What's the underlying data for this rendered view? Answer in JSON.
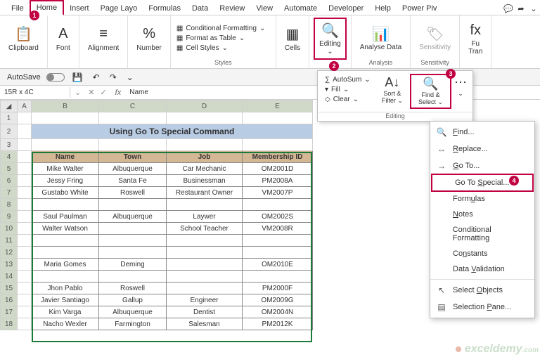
{
  "tabs": [
    "File",
    "Home",
    "Insert",
    "Page Layo",
    "Formulas",
    "Data",
    "Review",
    "View",
    "Automate",
    "Developer",
    "Help",
    "Power Piv"
  ],
  "ribbon": {
    "clipboard": "Clipboard",
    "font": "Font",
    "alignment": "Alignment",
    "number": "Number",
    "styles_label": "Styles",
    "cond_fmt": "Conditional Formatting",
    "fmt_table": "Format as Table",
    "cell_styles": "Cell Styles",
    "cells": "Cells",
    "editing": "Editing",
    "analysis_label": "Analysis",
    "analyse": "Analyse Data",
    "sensitivity_label": "Sensitivity",
    "sensitivity": "Sensitivity",
    "fu": "Fu",
    "tran": "Tran"
  },
  "autosave": "AutoSave",
  "dropdown": {
    "autosum": "AutoSum",
    "fill": "Fill",
    "clear": "Clear",
    "sort": "Sort & Filter",
    "find": "Find & Select",
    "editing": "Editing"
  },
  "menu": {
    "find": "Find...",
    "replace": "Replace...",
    "goto": "Go To...",
    "special": "Go To Special...",
    "formulas": "Formulas",
    "notes": "Notes",
    "cond": "Conditional Formatting",
    "constants": "Constants",
    "dataval": "Data Validation",
    "selobj": "Select Objects",
    "selpane": "Selection Pane..."
  },
  "namebox": "15R x 4C",
  "fx_value": "Name",
  "title": "Using Go To Special Command",
  "headers": [
    "Name",
    "Town",
    "Job",
    "Membership ID"
  ],
  "rows": [
    [
      "Mike Walter",
      "Albuquerque",
      "Car Mechanic",
      "OM2001D"
    ],
    [
      "Jessy Fring",
      "Santa Fe",
      "Businessman",
      "PM2008A"
    ],
    [
      "Gustabo White",
      "Roswell",
      "Restaurant Owner",
      "VM2007P"
    ],
    [
      "",
      "",
      "",
      ""
    ],
    [
      "Saul Paulman",
      "Albuquerque",
      "Laywer",
      "OM2002S"
    ],
    [
      "Walter Watson",
      "",
      "School Teacher",
      "VM2008R"
    ],
    [
      "",
      "",
      "",
      ""
    ],
    [
      "",
      "",
      "",
      ""
    ],
    [
      "Maria Gomes",
      "Deming",
      "",
      "OM2010E"
    ],
    [
      "",
      "",
      "",
      ""
    ],
    [
      "Jhon Pablo",
      "Roswell",
      "",
      "PM2000F"
    ],
    [
      "Javier Santiago",
      "Gallup",
      "Engineer",
      "OM2009G"
    ],
    [
      "Kim Varga",
      "Albuquerque",
      "Dentist",
      "OM2004N"
    ],
    [
      "Nacho Wexler",
      "Farmington",
      "Salesman",
      "PM2012K"
    ]
  ],
  "watermark": "exceldemy",
  "callouts": {
    "1": "1",
    "2": "2",
    "3": "3",
    "4": "4"
  }
}
